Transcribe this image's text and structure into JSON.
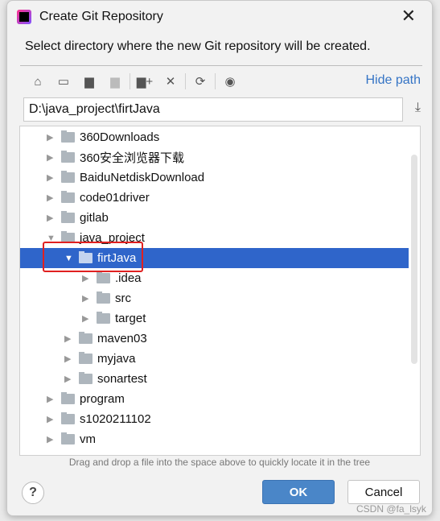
{
  "window": {
    "title": "Create Git Repository",
    "close_icon": "close-icon"
  },
  "description": "Select directory where the new Git repository will be created.",
  "toolbar": {
    "icons": [
      "home-icon",
      "desktop-icon",
      "project-folder-icon",
      "module-folder-icon",
      "new-folder-icon",
      "delete-icon",
      "refresh-icon",
      "show-hidden-icon"
    ],
    "hide_path": "Hide path"
  },
  "path_value": "D:\\java_project\\firtJava",
  "tree": [
    {
      "label": "360Downloads",
      "level": 0,
      "expanded": false
    },
    {
      "label": "360安全浏览器下载",
      "level": 0,
      "expanded": false
    },
    {
      "label": "BaiduNetdiskDownload",
      "level": 0,
      "expanded": false
    },
    {
      "label": "code01driver",
      "level": 0,
      "expanded": false
    },
    {
      "label": "gitlab",
      "level": 0,
      "expanded": false
    },
    {
      "label": "java_project",
      "level": 0,
      "expanded": true
    },
    {
      "label": "firtJava",
      "level": 1,
      "expanded": true,
      "selected": true
    },
    {
      "label": ".idea",
      "level": 2,
      "expanded": false
    },
    {
      "label": "src",
      "level": 2,
      "expanded": false
    },
    {
      "label": "target",
      "level": 2,
      "expanded": false
    },
    {
      "label": "maven03",
      "level": 1,
      "expanded": false
    },
    {
      "label": "myjava",
      "level": 1,
      "expanded": false
    },
    {
      "label": "sonartest",
      "level": 1,
      "expanded": false
    },
    {
      "label": "program",
      "level": 0,
      "expanded": false
    },
    {
      "label": "s1020211102",
      "level": 0,
      "expanded": false
    },
    {
      "label": "vm",
      "level": 0,
      "expanded": false
    }
  ],
  "hint": "Drag and drop a file into the space above to quickly locate it in the tree",
  "buttons": {
    "help": "?",
    "ok": "OK",
    "cancel": "Cancel"
  },
  "watermark": "CSDN @fa_lsyk",
  "colors": {
    "selection": "#2f65ca",
    "link": "#3574c5",
    "ok": "#4a86c8",
    "highlight_box": "#e02020"
  }
}
